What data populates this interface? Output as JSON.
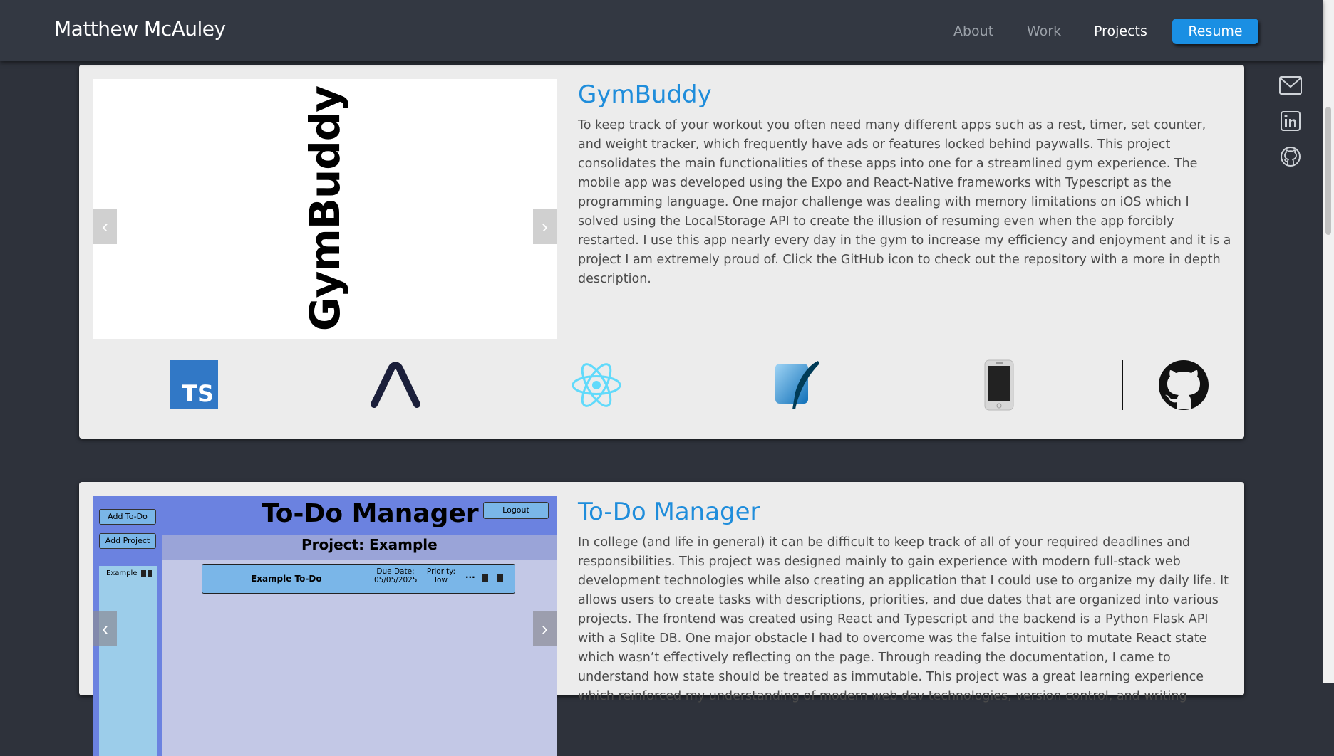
{
  "brand": "Matthew McAuley",
  "nav": {
    "about": "About",
    "work": "Work",
    "projects": "Projects",
    "resume": "Resume"
  },
  "social_icons": [
    "mail-icon",
    "linkedin-icon",
    "github-icon"
  ],
  "colors": {
    "accent": "#1a8fe3",
    "title": "#1f8ddb",
    "background": "#2e323b",
    "card": "#ececec"
  },
  "projects": [
    {
      "title": "GymBuddy",
      "logo_text": "GymBuddy",
      "description": "To keep track of your workout you often need many different apps such as a rest, timer, set counter, and weight tracker, which frequently have ads or features locked behind paywalls. This project consolidates the main functionalities of these apps into one for a streamlined gym experience. The mobile app was developed using the Expo and React-Native frameworks with Typescript as the programming language. One major challenge was dealing with memory limitations on iOS which I solved using the LocalStorage API to create the illusion of resuming even when the app forcibly restarted. I use this app nearly every day in the gym to increase my efficiency and enjoyment and it is a project I am extremely proud of. Click the GitHub icon to check out the repository with a more in depth description.",
      "tech": [
        "typescript-icon",
        "expo-icon",
        "react-icon",
        "sqlite-icon",
        "mobile-phone-icon",
        "github-icon"
      ],
      "ts_label": "TS"
    },
    {
      "title": "To-Do Manager",
      "description": "In college (and life in general) it can be difficult to keep track of all of your required deadlines and responsibilities. This project was designed mainly to gain experience with modern full-stack web development technologies while also creating an application that I could use to organize my daily life. It allows users to create tasks with descriptions, priorities, and due dates that are organized into various projects. The frontend was created using React and Typescript and the backend is a Python Flask API with a Sqlite DB. One major obstacle I had to overcome was the false intuition to mutate React state which wasn’t effectively reflecting on the page. Through reading the documentation, I came to understand how state should be treated as immutable. This project was a great learning experience which reinforced my understanding of modern web dev technologies, version control, and writing",
      "screenshot": {
        "app_title": "To-Do Manager",
        "add_todo": "Add To-Do",
        "add_project": "Add Project",
        "logout": "Logout",
        "project_heading": "Project: Example",
        "sidebar_item": "Example",
        "todo_name": "Example To-Do",
        "due_label": "Due Date:",
        "due_value": "05/05/2025",
        "priority_label": "Priority:",
        "priority_value": "low",
        "more": "···"
      }
    }
  ]
}
